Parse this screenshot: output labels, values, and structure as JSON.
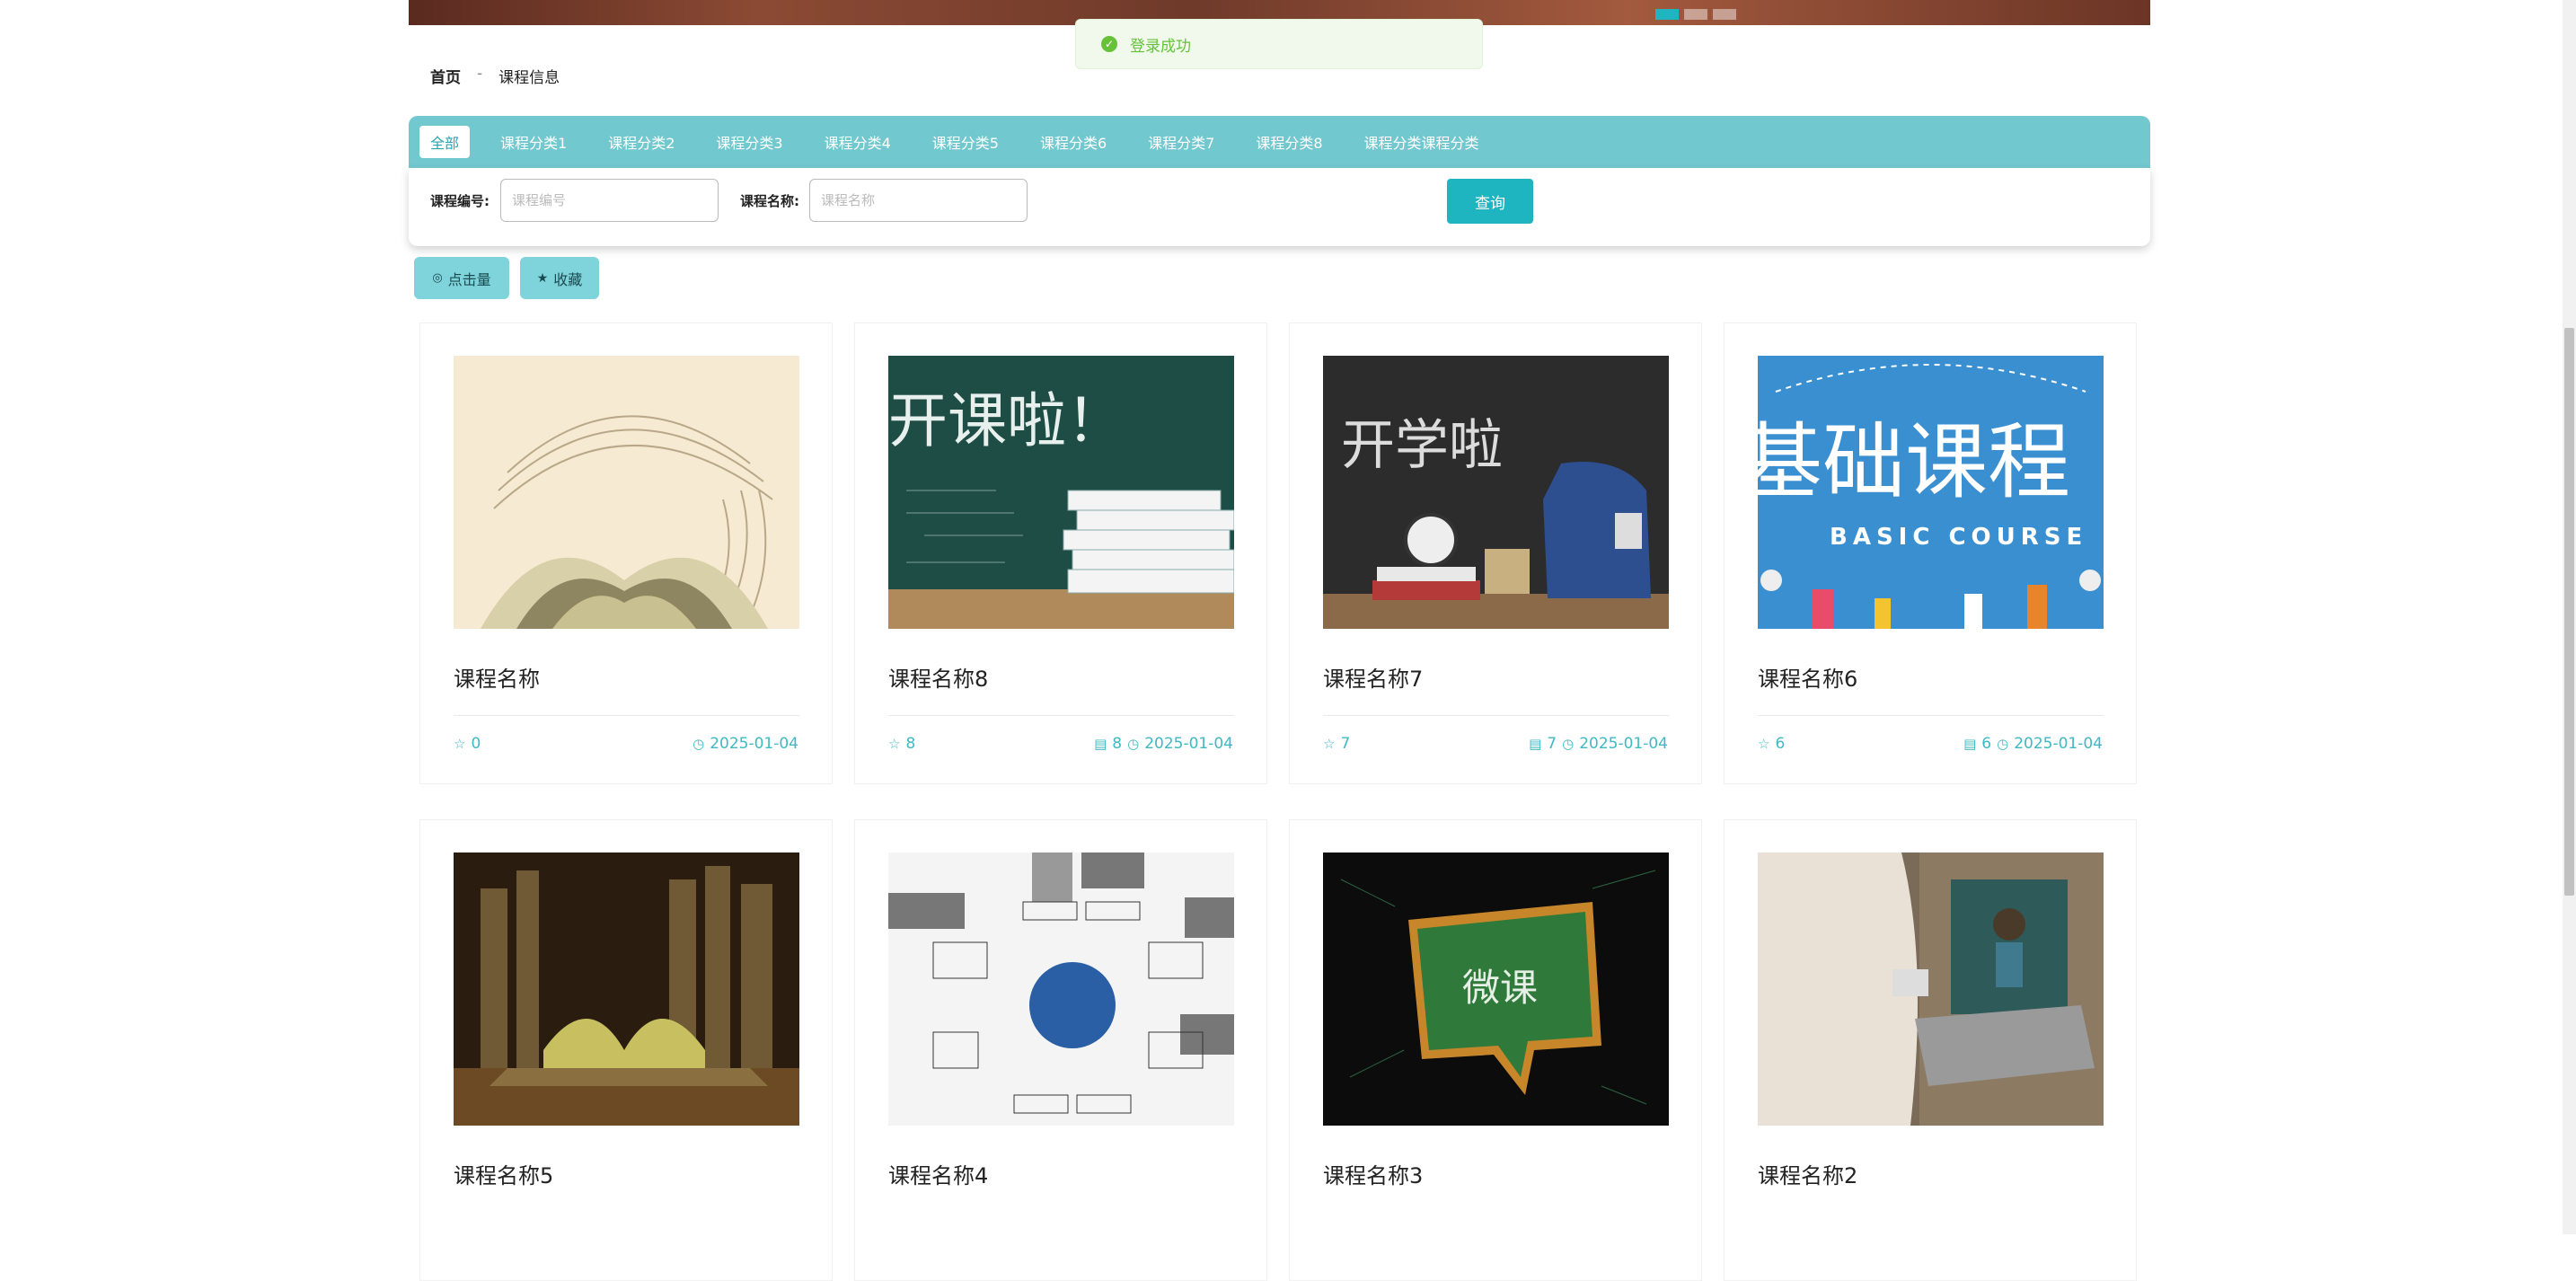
{
  "toast": {
    "message": "登录成功"
  },
  "breadcrumb": {
    "home": "首页",
    "separator": "-",
    "current": "课程信息"
  },
  "categories": [
    {
      "label": "全部",
      "active": true
    },
    {
      "label": "课程分类1"
    },
    {
      "label": "课程分类2"
    },
    {
      "label": "课程分类3"
    },
    {
      "label": "课程分类4"
    },
    {
      "label": "课程分类5"
    },
    {
      "label": "课程分类6"
    },
    {
      "label": "课程分类7"
    },
    {
      "label": "课程分类8"
    },
    {
      "label": "课程分类课程分类"
    }
  ],
  "search": {
    "code_label": "课程编号:",
    "code_placeholder": "课程编号",
    "name_label": "课程名称:",
    "name_placeholder": "课程名称",
    "query_button": "查询"
  },
  "sort": {
    "clicks": "点击量",
    "favorite": "收藏"
  },
  "courses": [
    {
      "name": "课程名称",
      "stars": "0",
      "date": "2025-01-04"
    },
    {
      "name": "课程名称8",
      "stars": "8",
      "views": "8",
      "date": "2025-01-04"
    },
    {
      "name": "课程名称7",
      "stars": "7",
      "views": "7",
      "date": "2025-01-04"
    },
    {
      "name": "课程名称6",
      "stars": "6",
      "views": "6",
      "date": "2025-01-04"
    },
    {
      "name": "课程名称5"
    },
    {
      "name": "课程名称4"
    },
    {
      "name": "课程名称3"
    },
    {
      "name": "课程名称2"
    }
  ],
  "image_texts": {
    "open_class": "开课啦！",
    "school_start": "开学啦",
    "basic_cn": "基础课程",
    "basic_en": "BASIC COURSE",
    "weike": "微课"
  },
  "colors": {
    "accent": "#1fb5c0",
    "category_bar": "#72c8cf",
    "success": "#67c23a"
  }
}
